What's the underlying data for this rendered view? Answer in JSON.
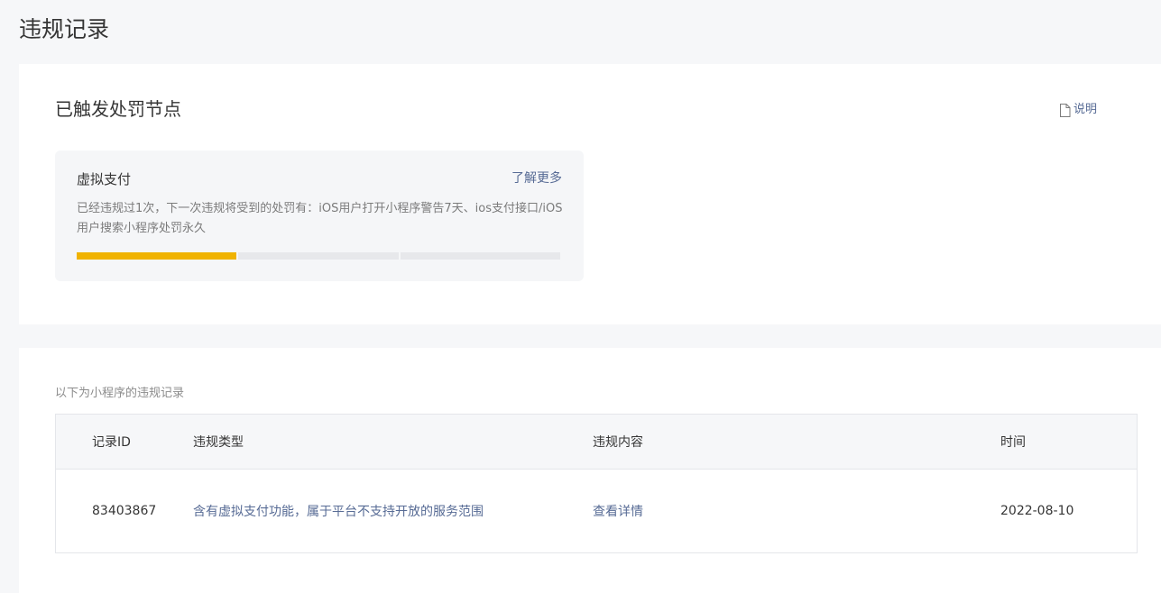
{
  "page": {
    "title": "违规记录"
  },
  "penalty_section": {
    "title": "已触发处罚节点",
    "help_label": "说明",
    "help_icon": "document-icon",
    "card": {
      "title": "虚拟支付",
      "learn_more_label": "了解更多",
      "description": "已经违规过1次，下一次违规将受到的处罚有：iOS用户打开小程序警告7天、ios支付接口/iOS用户搜索小程序处罚永久",
      "progress": {
        "total_stages": 3,
        "completed_stages": 1,
        "active_color": "#f0b300",
        "inactive_color": "#e7e8eb"
      }
    }
  },
  "records_section": {
    "intro": "以下为小程序的违规记录",
    "columns": [
      "记录ID",
      "违规类型",
      "违规内容",
      "时间"
    ],
    "rows": [
      {
        "id": "83403867",
        "type": "含有虚拟支付功能，属于平台不支持开放的服务范围",
        "content": "查看详情",
        "time": "2022-08-10"
      }
    ]
  },
  "colors": {
    "link": "#576b95",
    "text": "#353535",
    "muted": "#7b7b7b",
    "page_bg": "#f6f7f9"
  }
}
